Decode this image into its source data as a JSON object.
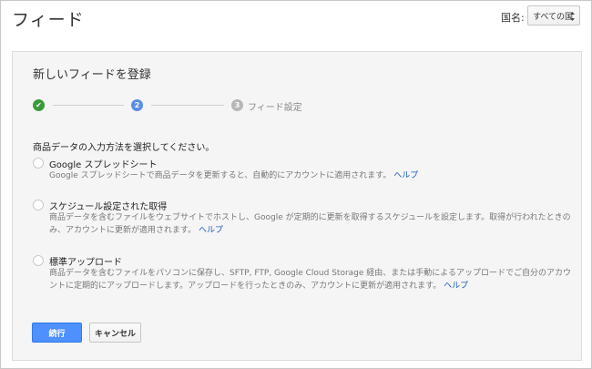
{
  "header": {
    "title": "フィード",
    "country_label": "国名:",
    "country_value": "すべての国"
  },
  "panel": {
    "title": "新しいフィードを登録",
    "steps": [
      {
        "label": "",
        "glyph": "✔"
      },
      {
        "label": "",
        "glyph": "2"
      },
      {
        "label": "フィード設定",
        "glyph": "3"
      }
    ],
    "prompt": "商品データの入力方法を選択してください。",
    "options": [
      {
        "title": "Google スプレッドシート",
        "description": "Google スプレッドシートで商品データを更新すると、自動的にアカウントに適用されます。",
        "help": "ヘルプ"
      },
      {
        "title": "スケジュール設定された取得",
        "description": "商品データを含むファイルをウェブサイトでホストし、Google が定期的に更新を取得するスケジュールを設定します。取得が行われたときのみ、アカウントに更新が適用されます。",
        "help": "ヘルプ"
      },
      {
        "title": "標準アップロード",
        "description": "商品データを含むファイルをパソコンに保存し、SFTP, FTP, Google Cloud Storage 経由、または手動によるアップロードでご自分のアカウントに定期的にアップロードします。アップロードを行ったときのみ、アカウントに更新が適用されます。",
        "help": "ヘルプ"
      }
    ],
    "buttons": {
      "continue": "続行",
      "cancel": "キャンセル"
    }
  },
  "colors": {
    "primary": "#4d90fe",
    "step_done": "#3a9a3a",
    "step_current": "#5a8ee6",
    "step_pending": "#b7b7b7",
    "link": "#1a5cc4"
  }
}
